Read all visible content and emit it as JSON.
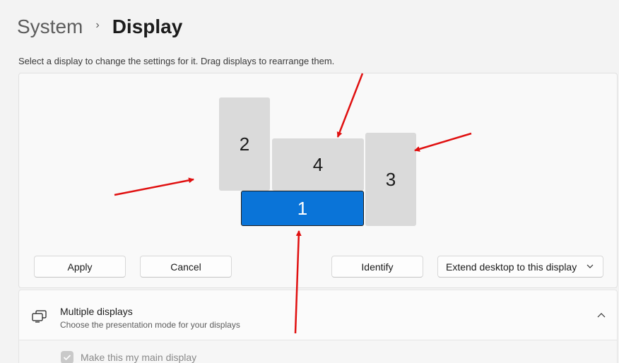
{
  "breadcrumb": {
    "parent": "System",
    "separator": "›",
    "current": "Display"
  },
  "instruction": "Select a display to change the settings for it. Drag displays to rearrange them.",
  "monitors": [
    {
      "label": "1",
      "selected": true
    },
    {
      "label": "2",
      "selected": false
    },
    {
      "label": "3",
      "selected": false
    },
    {
      "label": "4",
      "selected": false
    }
  ],
  "buttons": {
    "apply": "Apply",
    "cancel": "Cancel",
    "identify": "Identify"
  },
  "extend_dropdown": {
    "value": "Extend desktop to this display",
    "icon": "chevron-down-icon"
  },
  "multiple_displays": {
    "title": "Multiple displays",
    "subtitle": "Choose the presentation mode for your displays",
    "icon": "multiple-displays-icon",
    "expanded": true
  },
  "main_display_checkbox": {
    "label": "Make this my main display",
    "checked": true,
    "disabled": true
  },
  "colors": {
    "selected_monitor": "#0a74d8",
    "monitor": "#dadada",
    "annotation_arrow": "#e01010"
  }
}
